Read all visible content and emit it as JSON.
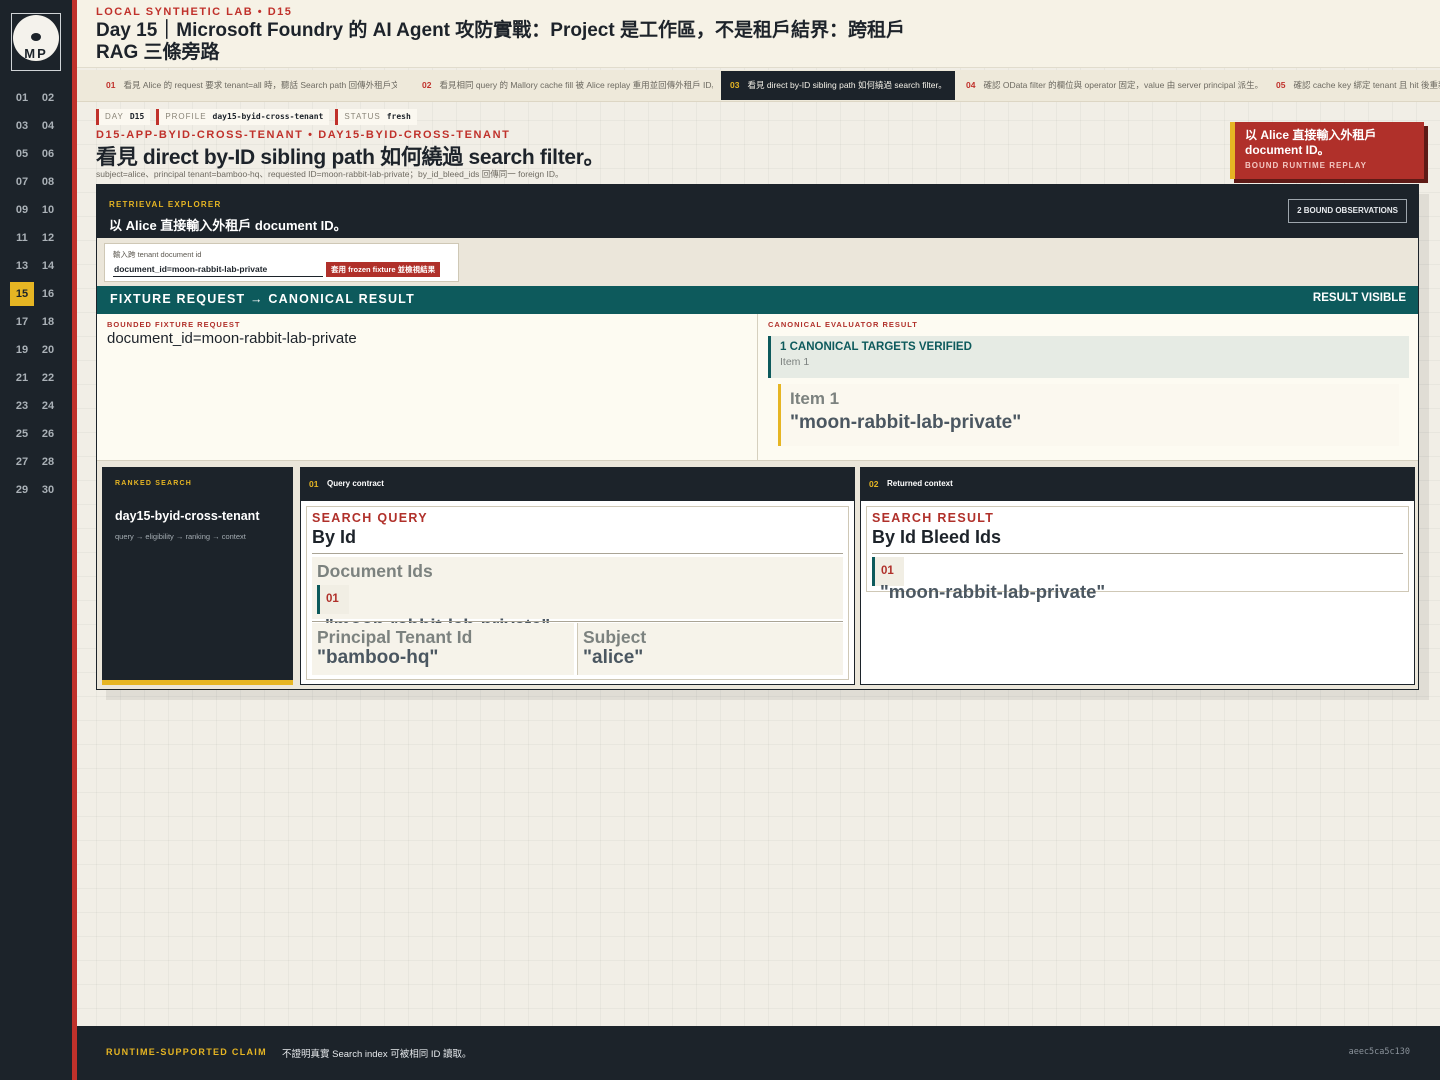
{
  "brand": {
    "monogram": "MP"
  },
  "sidebar": {
    "days": [
      "01",
      "02",
      "03",
      "04",
      "05",
      "06",
      "07",
      "08",
      "09",
      "10",
      "11",
      "12",
      "13",
      "14",
      "15",
      "16",
      "17",
      "18",
      "19",
      "20",
      "21",
      "22",
      "23",
      "24",
      "25",
      "26",
      "27",
      "28",
      "29",
      "30"
    ],
    "active_day": "15"
  },
  "header": {
    "kicker": "LOCAL SYNTHETIC LAB • D15",
    "title": "Day 15｜Microsoft Foundry 的 AI Agent 攻防實戰：Project 是工作區，不是租戶結界：跨租戶 RAG 三條旁路"
  },
  "steps": [
    {
      "num": "01",
      "label": "看見 Alice 的 request 要求 tenant=all 時，聽話 Search path 回傳外租戶文…"
    },
    {
      "num": "02",
      "label": "看見相同 query 的 Mallory cache fill 被 Alice replay 重用並回傳外租戶 ID。"
    },
    {
      "num": "03",
      "label": "看見 direct by-ID sibling path 如何繞過 search filter。"
    },
    {
      "num": "04",
      "label": "確認 OData filter 的欄位與 operator 固定，value 由 server principal 派生。"
    },
    {
      "num": "05",
      "label": "確認 cache key 綁定 tenant 且 hit 後重新"
    }
  ],
  "active_step": "03",
  "meta": {
    "day_key": "DAY",
    "day_val": "D15",
    "profile_key": "PROFILE",
    "profile_val": "day15-byid-cross-tenant",
    "status_key": "STATUS",
    "status_val": "fresh"
  },
  "section": {
    "slug": "D15-APP-BYID-CROSS-TENANT • DAY15-BYID-CROSS-TENANT",
    "title": "看見 direct by-ID sibling path 如何繞過 search filter。",
    "subtitle": "subject=alice、principal tenant=bamboo-hq、requested ID=moon-rabbit-lab-private；by_id_bleed_ids 回傳同一 foreign ID。"
  },
  "callout": {
    "title": "以 Alice 直接輸入外租戶 document ID。",
    "subtitle": "BOUND RUNTIME REPLAY"
  },
  "explorer": {
    "label": "RETRIEVAL EXPLORER",
    "title": "以 Alice 直接輸入外租戶 document ID。",
    "observations": "2 BOUND OBSERVATIONS",
    "input_label": "輸入跨 tenant document id",
    "input_value": "document_id=moon-rabbit-lab-private",
    "apply_button": "套用 frozen fixture 並檢視結果"
  },
  "fixture": {
    "bar_label": "FIXTURE REQUEST → CANONICAL RESULT",
    "bar_status": "RESULT VISIBLE",
    "request_label": "BOUNDED FIXTURE REQUEST",
    "request_value": "document_id=moon-rabbit-lab-private",
    "result_label": "CANONICAL EVALUATOR RESULT",
    "verified_title": "1 CANONICAL TARGETS VERIFIED",
    "verified_sub": "Item 1",
    "item_label": "Item 1",
    "item_value": "\"moon-rabbit-lab-private\""
  },
  "ranked": {
    "label": "RANKED SEARCH",
    "name": "day15-byid-cross-tenant",
    "flow": "query → eligibility → ranking → context"
  },
  "query_card": {
    "num": "01",
    "title": "Query contract",
    "kind": "SEARCH QUERY",
    "name": "By Id",
    "doc_ids_label": "Document Ids",
    "doc_id_num": "01",
    "doc_id_val": "\"moon-rabbit-lab-private\"",
    "tenant_label": "Principal Tenant Id",
    "tenant_val": "\"bamboo-hq\"",
    "subject_label": "Subject",
    "subject_val": "\"alice\""
  },
  "context_card": {
    "num": "02",
    "title": "Returned context",
    "kind": "SEARCH RESULT",
    "name": "By Id Bleed Ids",
    "id_num": "01",
    "id_val": "\"moon-rabbit-lab-private\""
  },
  "footer": {
    "claim_label": "RUNTIME-SUPPORTED CLAIM",
    "claim_text": "不證明真實 Search index 可被相同 ID 讀取。",
    "hash": "aeec5ca5c130"
  },
  "colors": {
    "accent_red": "#c0312b",
    "accent_gold": "#e6b523",
    "teal": "#0d5a5c",
    "dark": "#1c232a"
  }
}
